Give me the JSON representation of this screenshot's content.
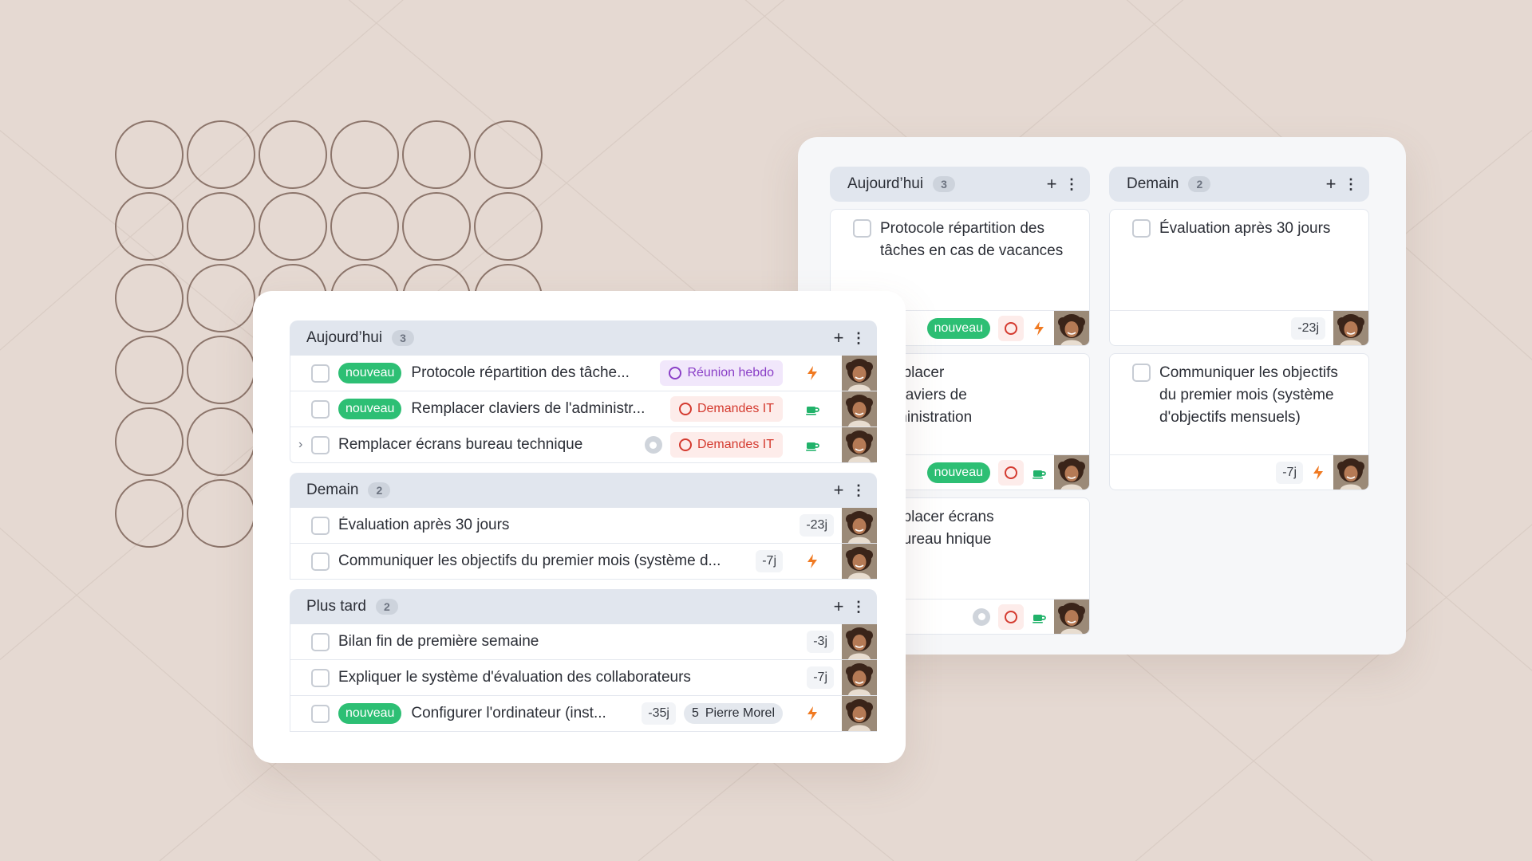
{
  "kanban": {
    "columns": [
      {
        "title": "Aujourd’hui",
        "count": "3",
        "cards": [
          {
            "text": "Protocole répartition des tâches en cas de vacances",
            "pill": "nouveau"
          },
          {
            "text": "nplacer claviers de ministration",
            "pill": "nouveau"
          },
          {
            "text": "nplacer écrans bureau hnique"
          }
        ]
      },
      {
        "title": "Demain",
        "count": "2",
        "cards": [
          {
            "text": "Évaluation après 30 jours",
            "days": "-23j"
          },
          {
            "text": "Communiquer les objectifs du premier mois (système d'objectifs mensuels)",
            "days": "-7j"
          }
        ]
      }
    ]
  },
  "list": {
    "groups": [
      {
        "title": "Aujourd’hui",
        "count": "3",
        "rows": [
          {
            "pill": "nouveau",
            "text": "Protocole répartition des tâche...",
            "tag": "Réunion hebdo"
          },
          {
            "pill": "nouveau",
            "text": "Remplacer claviers de l'administr...",
            "tag": "Demandes IT"
          },
          {
            "text": "Remplacer écrans bureau technique",
            "tag": "Demandes IT"
          }
        ]
      },
      {
        "title": "Demain",
        "count": "2",
        "rows": [
          {
            "text": "Évaluation après 30 jours",
            "days": "-23j"
          },
          {
            "text": "Communiquer les objectifs du premier mois (système d...",
            "days": "-7j"
          }
        ]
      },
      {
        "title": "Plus tard",
        "count": "2",
        "rows": [
          {
            "text": "Bilan fin de première semaine",
            "days": "-3j"
          },
          {
            "text": "Expliquer le système d'évaluation des collaborateurs",
            "days": "-7j"
          },
          {
            "pill": "nouveau",
            "text": "Configurer l'ordinateur (inst...",
            "days": "-35j",
            "person_count": "5",
            "person_name": "Pierre Morel"
          }
        ]
      }
    ]
  },
  "icons": {
    "add": "plus-icon",
    "menu": "kebab-menu-icon",
    "priority": "lightning-icon",
    "effort": "coffee-cup-icon",
    "status": "ring-icon",
    "expand": "chevron-right-icon"
  },
  "colors": {
    "background": "#e5d9d2",
    "new_pill": "#2dbf74",
    "priority": "#f07a22",
    "effort": "#21b26a",
    "tag_purple": "#8a3fc7",
    "tag_red": "#d43a2f",
    "header": "#e1e6ee"
  }
}
